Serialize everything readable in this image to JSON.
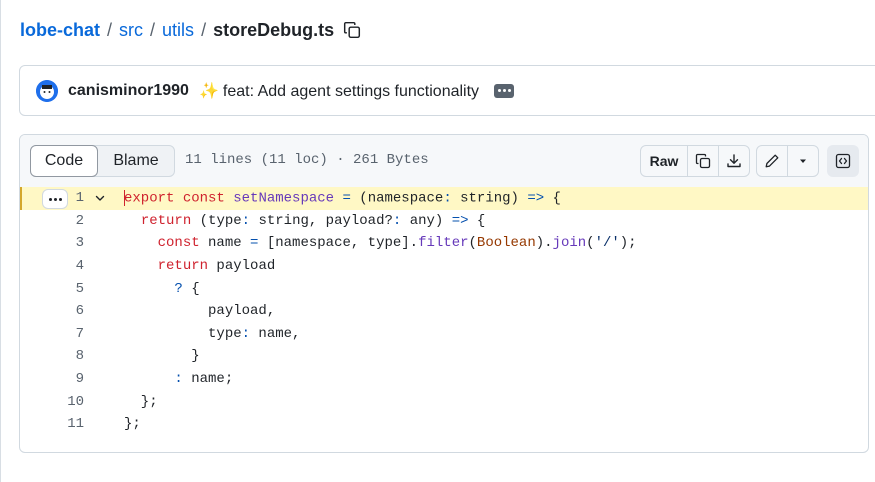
{
  "breadcrumb": {
    "repo": "lobe-chat",
    "dirs": [
      "src",
      "utils"
    ],
    "separator": "/",
    "file": "storeDebug.ts"
  },
  "commit": {
    "author": "canisminor1990",
    "sparkle": "✨",
    "message": "feat: Add agent settings functionality"
  },
  "file_header": {
    "tabs": [
      "Code",
      "Blame"
    ],
    "active_tab": "Code",
    "info": "11 lines (11 loc) · 261 Bytes",
    "raw_label": "Raw"
  },
  "code": {
    "line_numbers": [
      "1",
      "2",
      "3",
      "4",
      "5",
      "6",
      "7",
      "8",
      "9",
      "10",
      "11"
    ],
    "lines": [
      "export const setNamespace = (namespace: string) => {",
      "  return (type: string, payload?: any) => {",
      "    const name = [namespace, type].filter(Boolean).join('/');",
      "    return payload",
      "      ? {",
      "          payload,",
      "          type: name,",
      "        }",
      "      : name;",
      "  };",
      "};"
    ]
  },
  "colors": {
    "link": "#0969da",
    "keyword": "#cf222e",
    "function": "#6639ba",
    "builtin": "#953800",
    "operator": "#0550ae",
    "highlight": "#fff8c5"
  }
}
